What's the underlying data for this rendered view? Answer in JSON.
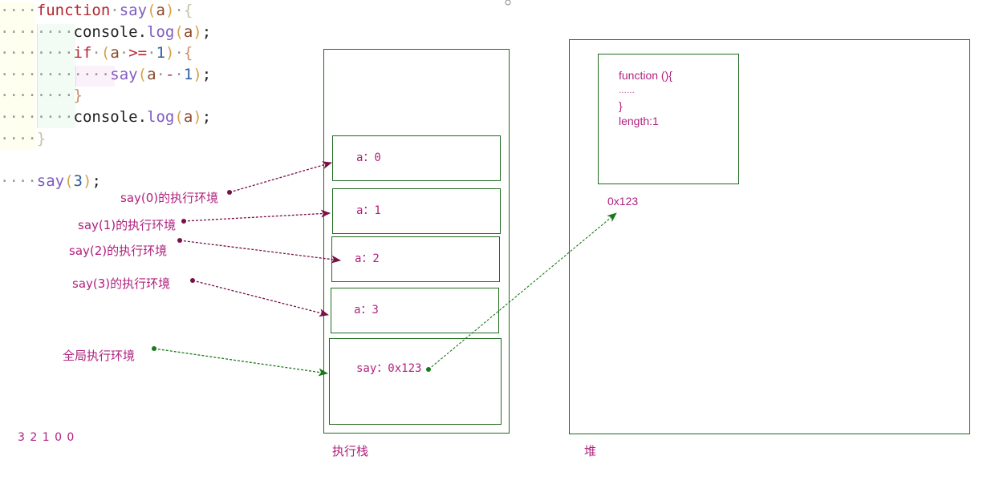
{
  "code": {
    "lines": [
      {
        "indent": "····",
        "tokens": [
          [
            "kw",
            "function"
          ],
          [
            "ws",
            "·"
          ],
          [
            "fn",
            "say"
          ],
          [
            "par",
            "("
          ],
          [
            "var",
            "a"
          ],
          [
            "par",
            ")"
          ],
          [
            "ws",
            "·"
          ],
          [
            "brace-dim",
            "{"
          ]
        ]
      },
      {
        "indent": "········",
        "tokens": [
          [
            "pn",
            "console."
          ],
          [
            "fn",
            "log"
          ],
          [
            "par",
            "("
          ],
          [
            "var",
            "a"
          ],
          [
            "par",
            ")"
          ],
          [
            "pn",
            ";"
          ]
        ]
      },
      {
        "indent": "········",
        "tokens": [
          [
            "kw",
            "if"
          ],
          [
            "ws",
            "·"
          ],
          [
            "par",
            "("
          ],
          [
            "var",
            "a"
          ],
          [
            "ws",
            "·"
          ],
          [
            "kw",
            ">="
          ],
          [
            "ws",
            "·"
          ],
          [
            "num",
            "1"
          ],
          [
            "par",
            ")"
          ],
          [
            "ws",
            "·"
          ],
          [
            "par2",
            "{"
          ]
        ]
      },
      {
        "indent": "············",
        "tokens": [
          [
            "fn",
            "say"
          ],
          [
            "par",
            "("
          ],
          [
            "var",
            "a"
          ],
          [
            "ws",
            "·"
          ],
          [
            "kw",
            "-"
          ],
          [
            "ws",
            "·"
          ],
          [
            "num",
            "1"
          ],
          [
            "par",
            ")"
          ],
          [
            "pn",
            ";"
          ]
        ]
      },
      {
        "indent": "········",
        "tokens": [
          [
            "brace-2",
            "}"
          ]
        ]
      },
      {
        "indent": "········",
        "tokens": [
          [
            "pn",
            "console."
          ],
          [
            "fn",
            "log"
          ],
          [
            "par",
            "("
          ],
          [
            "var",
            "a"
          ],
          [
            "par",
            ")"
          ],
          [
            "pn",
            ";"
          ]
        ]
      },
      {
        "indent": "····",
        "tokens": [
          [
            "brace-dim",
            "}"
          ]
        ]
      },
      {
        "indent": "",
        "tokens": []
      },
      {
        "indent": "····",
        "tokens": [
          [
            "fn",
            "say"
          ],
          [
            "par",
            "("
          ],
          [
            "num",
            "3"
          ],
          [
            "par",
            ")"
          ],
          [
            "pn",
            ";"
          ]
        ]
      }
    ]
  },
  "labels": {
    "say0": "say(0)的执行环境",
    "say1": "say(1)的执行环境",
    "say2": "say(2)的执行环境",
    "say3": "say(3)的执行环境",
    "global": "全局执行环境",
    "output": "3 2 1 0 0",
    "stack_title": "执行栈",
    "heap_title": "堆",
    "heap_address": "0x123"
  },
  "stack": {
    "frames": [
      {
        "text": "a：0"
      },
      {
        "text": "a：1"
      },
      {
        "text": "a：2"
      },
      {
        "text": "a：3"
      },
      {
        "text": "say：0x123"
      }
    ]
  },
  "heap": {
    "object_lines": [
      "function (){",
      "……",
      "}",
      "length:1"
    ]
  },
  "colors": {
    "label": "#b0217e",
    "box": "#1f6b1f",
    "arrow_frame": "#7a1048",
    "arrow_global": "#1a7a1a"
  }
}
